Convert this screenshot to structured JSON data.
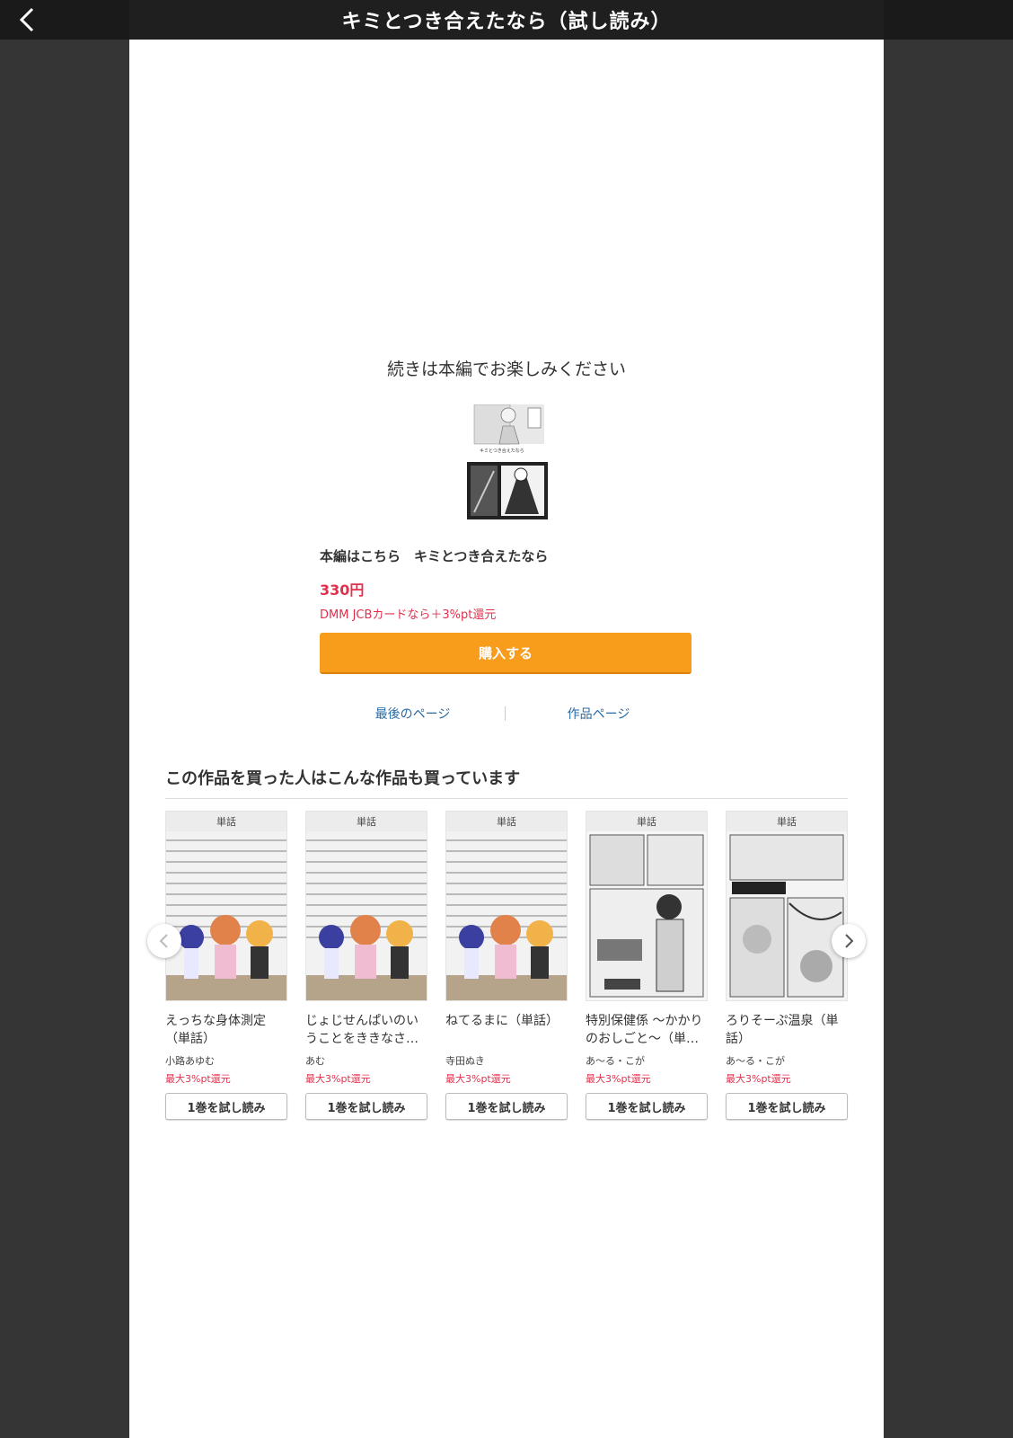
{
  "header": {
    "title": "キミとつき合えたなら（試し読み）"
  },
  "end_screen": {
    "message": "続きは本編でお楽しみください",
    "main_link_text": "本編はこちら　キミとつき合えたなら",
    "price": "330円",
    "point_note": "DMM JCBカードなら＋3%pt還元",
    "buy_label": "購入する",
    "link_last_page": "最後のページ",
    "link_work_page": "作品ページ",
    "cover_title": "キミとつき合えたなら"
  },
  "recommend": {
    "title": "この作品を買った人はこんな作品も買っています",
    "items": [
      {
        "badge": "単話",
        "title": "えっちな身体測定（単話）",
        "author": "小路あゆむ",
        "point": "最大3%pt還元",
        "button": "1巻を試し読み"
      },
      {
        "badge": "単話",
        "title": "じょじせんぱいのいうことをききなさ…",
        "author": "あむ",
        "point": "最大3%pt還元",
        "button": "1巻を試し読み"
      },
      {
        "badge": "単話",
        "title": "ねてるまに（単話）",
        "author": "寺田ぬき",
        "point": "最大3%pt還元",
        "button": "1巻を試し読み"
      },
      {
        "badge": "単話",
        "title": "特別保健係 〜かかりのおしごと〜（単…",
        "author": "あ〜る・こが",
        "point": "最大3%pt還元",
        "button": "1巻を試し読み"
      },
      {
        "badge": "単話",
        "title": "ろりそーぷ温泉（単話）",
        "author": "あ〜る・こが",
        "point": "最大3%pt還元",
        "button": "1巻を試し読み"
      }
    ]
  }
}
